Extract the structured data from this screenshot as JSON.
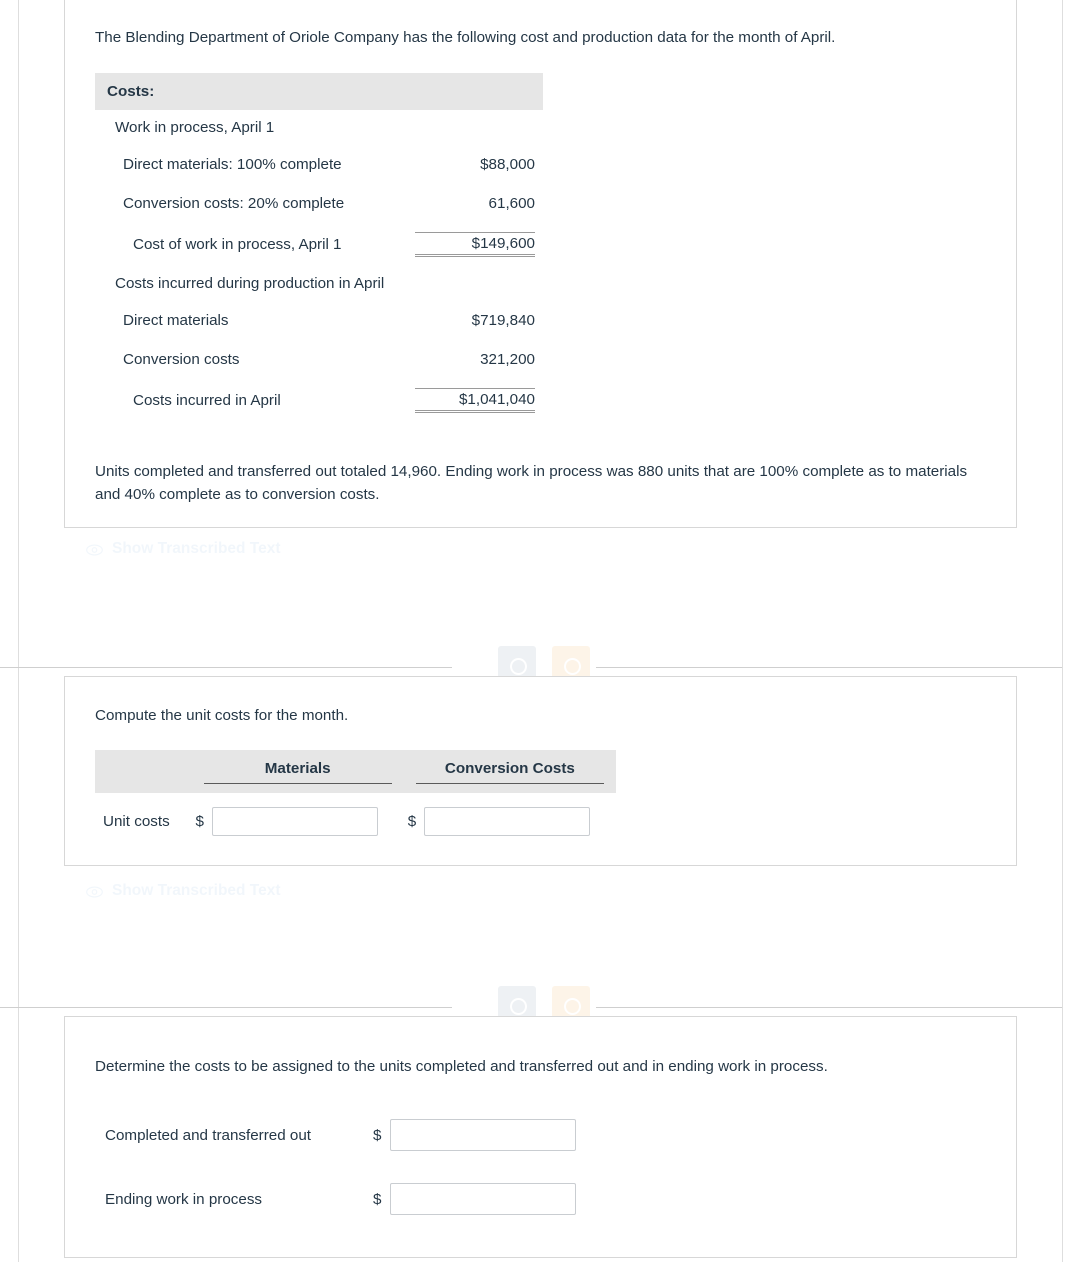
{
  "frame": {
    "tabs": [
      {
        "name": "tab-indicator-gray",
        "color": "#7b7b7b"
      },
      {
        "name": "tab-indicator-orange",
        "color": "#eda54b"
      }
    ]
  },
  "problem_card": {
    "intro": "The Blending Department of Oriole Company has the following cost and production data for the month of April.",
    "table": {
      "header": "Costs:",
      "rows": [
        {
          "label": "Work in process, April 1",
          "indent": 0,
          "amount": "",
          "rule": ""
        },
        {
          "label": "Direct materials: 100% complete",
          "indent": 1,
          "amount": "$88,000",
          "rule": ""
        },
        {
          "label": "Conversion costs: 20% complete",
          "indent": 1,
          "amount": "61,600",
          "rule": ""
        },
        {
          "label": "Cost of work in process, April 1",
          "indent": 2,
          "amount": "$149,600",
          "rule": "top-double"
        },
        {
          "label": "Costs incurred during production in April",
          "indent": 0,
          "amount": "",
          "rule": ""
        },
        {
          "label": "Direct materials",
          "indent": 1,
          "amount": "$719,840",
          "rule": ""
        },
        {
          "label": "Conversion costs",
          "indent": 1,
          "amount": "321,200",
          "rule": ""
        },
        {
          "label": "Costs incurred in April",
          "indent": 2,
          "amount": "$1,041,040",
          "rule": "top-double"
        }
      ]
    },
    "notes": "Units completed and transferred out totaled 14,960. Ending work in process was 880 units that are 100% complete as to materials and 40% complete as to conversion costs."
  },
  "transcribe": {
    "label": "Show Transcribed Text",
    "icon": "eye-icon"
  },
  "unit_cost_card": {
    "prompt": "Compute the unit costs for the month.",
    "columns": [
      "",
      "Materials",
      "Conversion Costs"
    ],
    "row_label": "Unit costs",
    "currency_symbol": "$",
    "materials_value": "",
    "conversion_value": "",
    "input_placeholder": ""
  },
  "assign_card": {
    "prompt": "Determine the costs to be assigned to the units completed and transferred out and in ending work in process.",
    "currency_symbol": "$",
    "rows": [
      {
        "label": "Completed and transferred out",
        "value": ""
      },
      {
        "label": "Ending work in process",
        "value": ""
      }
    ],
    "input_placeholder": ""
  },
  "colors": {
    "text": "#253746",
    "table_header_bg": "#e6e6e6",
    "card_border": "#d7d7d7",
    "link": "#1a75bb",
    "accent_orange": "#eda54b"
  }
}
